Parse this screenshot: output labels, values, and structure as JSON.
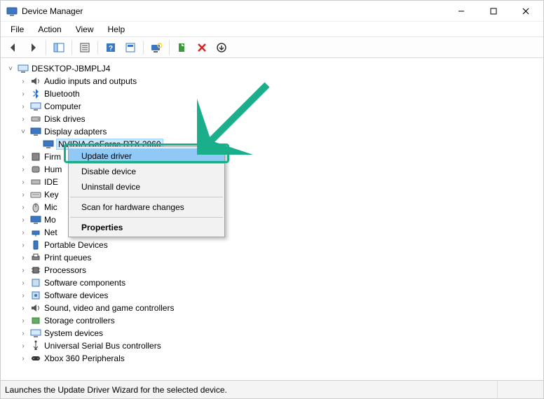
{
  "window": {
    "title": "Device Manager"
  },
  "menu": {
    "file": "File",
    "action": "Action",
    "view": "View",
    "help": "Help"
  },
  "tree": {
    "root": "DESKTOP-JBMPLJ4",
    "nodes": {
      "audio": "Audio inputs and outputs",
      "bluetooth": "Bluetooth",
      "computer": "Computer",
      "disk": "Disk drives",
      "display": "Display adapters",
      "display_child": "NVIDIA GeForce RTX 2060",
      "firmware": "Firm",
      "hid": "Hum",
      "ide": "IDE",
      "keyboards": "Key",
      "mice": "Mic",
      "monitors": "Mo",
      "network": "Net",
      "portable": "Portable Devices",
      "printq": "Print queues",
      "processors": "Processors",
      "swcomp": "Software components",
      "swdev": "Software devices",
      "sound": "Sound, video and game controllers",
      "storage": "Storage controllers",
      "system": "System devices",
      "usb": "Universal Serial Bus controllers",
      "xbox": "Xbox 360 Peripherals"
    }
  },
  "context_menu": {
    "update": "Update driver",
    "disable": "Disable device",
    "uninstall": "Uninstall device",
    "scan": "Scan for hardware changes",
    "properties": "Properties"
  },
  "statusbar": {
    "text": "Launches the Update Driver Wizard for the selected device."
  }
}
